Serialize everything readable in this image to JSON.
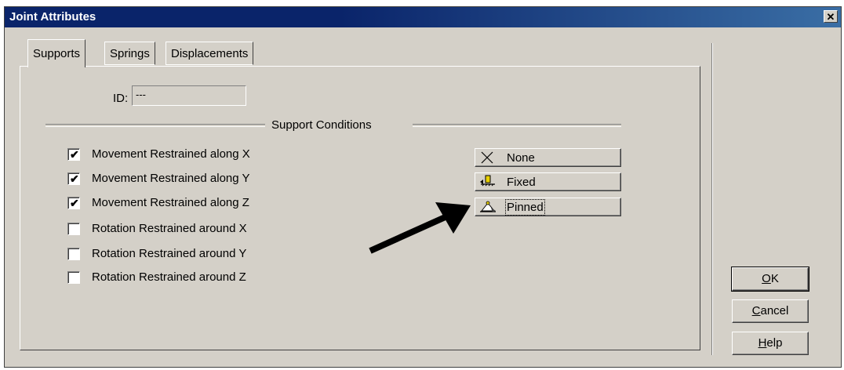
{
  "window": {
    "title": "Joint Attributes",
    "close_glyph": "✕"
  },
  "tabs": [
    {
      "label": "Supports",
      "active": true
    },
    {
      "label": "Springs",
      "active": false
    },
    {
      "label": "Displacements",
      "active": false
    }
  ],
  "id_field": {
    "label": "ID:",
    "value": "---"
  },
  "group": {
    "title": "Support Conditions"
  },
  "restraints": [
    {
      "label": "Movement Restrained along X",
      "checked": true
    },
    {
      "label": "Movement Restrained along Y",
      "checked": true
    },
    {
      "label": "Movement Restrained along Z",
      "checked": true
    },
    {
      "label": "Rotation Restrained around X",
      "checked": false
    },
    {
      "label": "Rotation Restrained around Y",
      "checked": false
    },
    {
      "label": "Rotation Restrained around Z",
      "checked": false
    }
  ],
  "condition_buttons": [
    {
      "label": "None",
      "icon": "x-icon"
    },
    {
      "label": "Fixed",
      "icon": "fixed-support-icon"
    },
    {
      "label": "Pinned",
      "icon": "pinned-support-icon",
      "focused": true
    }
  ],
  "dialog_buttons": {
    "ok": {
      "mnemonic": "O",
      "rest": "K"
    },
    "cancel": {
      "mnemonic": "C",
      "rest": "ancel"
    },
    "help": {
      "mnemonic": "H",
      "rest": "elp"
    }
  },
  "check_glyph": "✔"
}
